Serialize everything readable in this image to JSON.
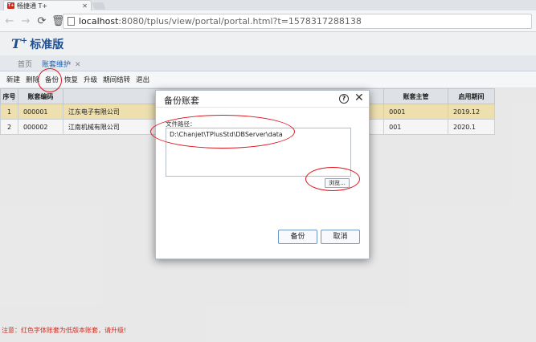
{
  "browser": {
    "tab_title": "畅捷通 T+",
    "favicon_text": "T+",
    "url_host": "localhost",
    "url_rest": ":8080/tplus/view/portal/portal.html?t=1578317288138"
  },
  "app": {
    "logo": "T",
    "logo_sup": "+",
    "product_name": "标准版",
    "tabs": [
      {
        "label": "首页"
      },
      {
        "label": "账套维护"
      }
    ],
    "toolbar": [
      "新建",
      "删除",
      "备份",
      "恢复",
      "升级",
      "期间结转",
      "退出"
    ]
  },
  "grid": {
    "headers": [
      "序号",
      "账套编码",
      "",
      "账套主管",
      "启用期间"
    ],
    "rows": [
      {
        "seq": "1",
        "code": "000001",
        "name": "江东电子有限公司",
        "manager": "0001",
        "period": "2019.12"
      },
      {
        "seq": "2",
        "code": "000002",
        "name": "江南机械有限公司",
        "manager": "001",
        "period": "2020.1"
      }
    ]
  },
  "footer_note": "注意：红色字体账套为低版本账套，请升级!",
  "dialog": {
    "title": "备份账套",
    "path_label": "文件路径：",
    "path_value": "D:\\Chanjet\\TPlusStd\\DBServer\\data",
    "browse_label": "浏览...",
    "backup_label": "备份",
    "cancel_label": "取消"
  },
  "colors": {
    "accent": "#1e62b8",
    "annotation": "#e0141e",
    "selected_row": "#f7e9b6",
    "warning_text": "#d93025"
  }
}
